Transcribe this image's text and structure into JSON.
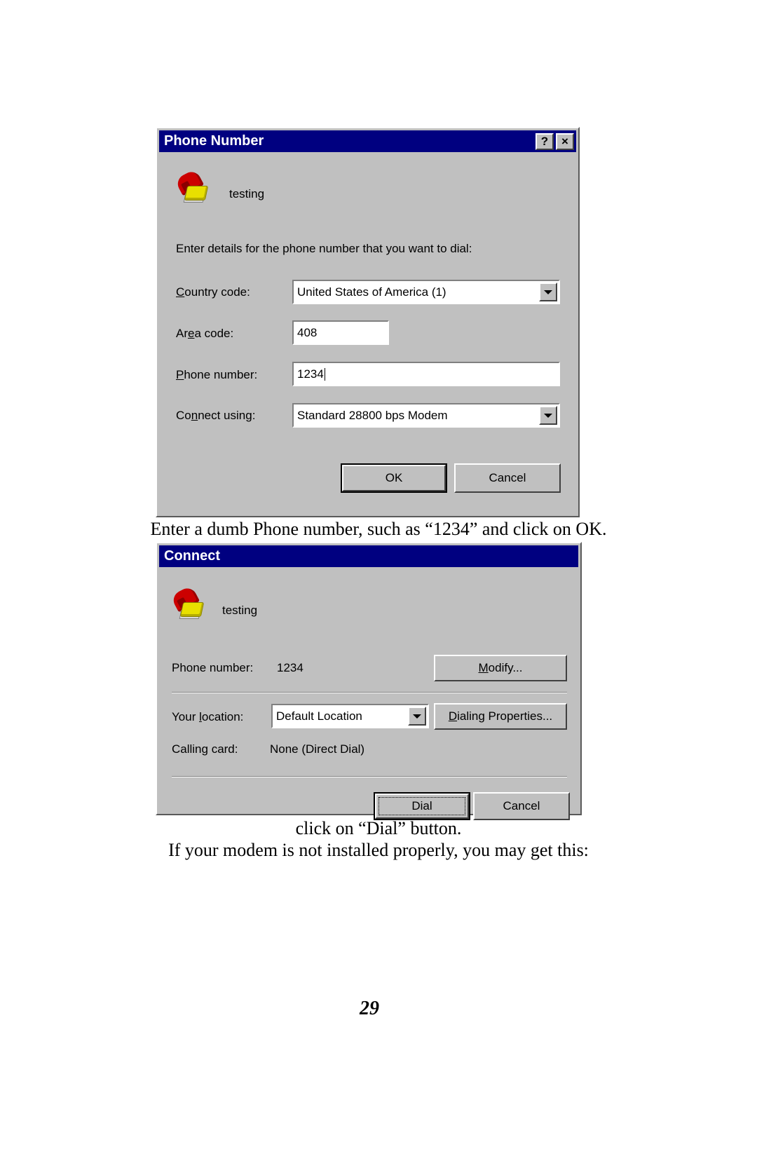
{
  "page": {
    "number": "29"
  },
  "dialog1": {
    "title": "Phone Number",
    "help_button": "?",
    "close_button": "×",
    "entry_name": "testing",
    "instruction": "Enter details for the phone number that you want to dial:",
    "fields": [
      {
        "label_pre": "C",
        "label_accel": "",
        "label": "Country code:",
        "value": "United States of America (1)",
        "type": "combobox"
      },
      {
        "label": "Area code:",
        "value": "408",
        "type": "textbox"
      },
      {
        "label": "Phone number:",
        "value": "1234",
        "type": "textbox"
      },
      {
        "label": "Connect using:",
        "value": "Standard 28800 bps Modem",
        "type": "combobox"
      }
    ],
    "labels": {
      "country_code": "Country code:",
      "area_code": "Area code:",
      "phone_number": "Phone number:",
      "connect_using": "Connect using:"
    },
    "values": {
      "country_code": "United States of America (1)",
      "area_code": "408",
      "phone_number": "1234",
      "connect_using": "Standard 28800 bps Modem"
    },
    "buttons": {
      "ok": "OK",
      "cancel": "Cancel"
    }
  },
  "caption1": "Enter a dumb Phone number, such as “1234” and click on OK.",
  "dialog2": {
    "title": "Connect",
    "entry_name": "testing",
    "labels": {
      "phone_number": "Phone number:",
      "your_location": "Your location:",
      "calling_card": "Calling card:"
    },
    "values": {
      "phone_number": "1234",
      "your_location": "Default Location",
      "calling_card": "None (Direct Dial)"
    },
    "buttons": {
      "modify": "Modify...",
      "dialing_properties": "Dialing Properties...",
      "dial": "Dial",
      "cancel": "Cancel"
    }
  },
  "caption2": "click on “Dial” button.",
  "caption3": "If your modem is not installed properly, you may get this:"
}
